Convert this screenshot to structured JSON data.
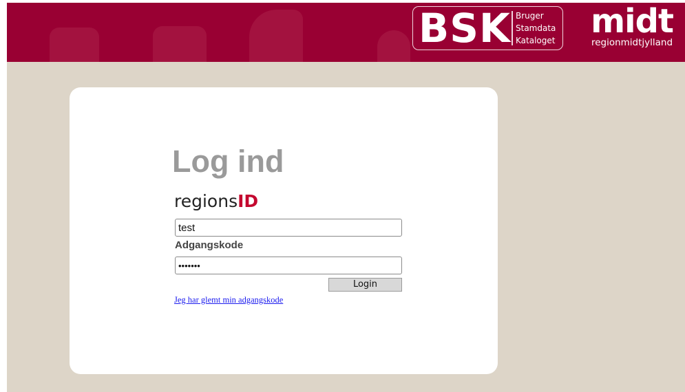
{
  "header": {
    "bsk_logo": {
      "letters": "BSK",
      "line1": "Bruger",
      "line2": "Stamdata",
      "line3": "Kataloget"
    },
    "region_logo": {
      "word": "midt",
      "subtitle": "regionmidtjylland"
    },
    "colors": {
      "brand": "#990033",
      "background": "#ddd5c8"
    }
  },
  "login": {
    "title": "Log ind",
    "provider_prefix": "regions",
    "provider_suffix": "ID",
    "username_value": "test",
    "password_label": "Adgangskode",
    "password_value": "•••••••",
    "login_button_label": "Login",
    "forgot_password_link": "Jeg har glemt min adgangskode"
  }
}
